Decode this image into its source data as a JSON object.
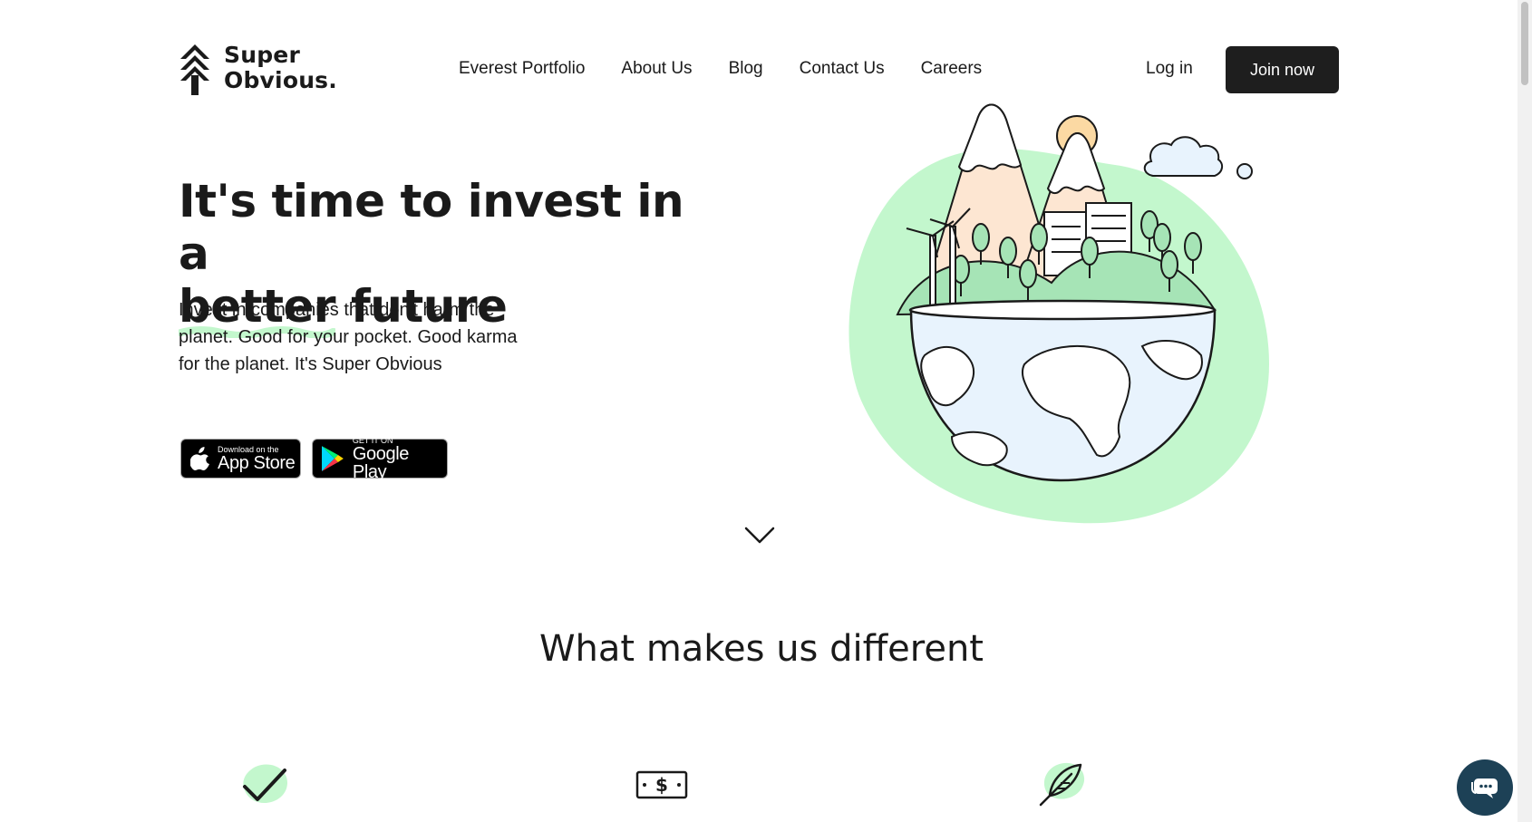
{
  "logo": {
    "line1": "Super",
    "line2": "Obvious."
  },
  "nav": {
    "items": [
      {
        "label": "Everest Portfolio"
      },
      {
        "label": "About Us"
      },
      {
        "label": "Blog"
      },
      {
        "label": "Contact Us"
      },
      {
        "label": "Careers"
      }
    ],
    "login_label": "Log in",
    "join_label": "Join now"
  },
  "hero": {
    "title_part1": "It's time to invest in a",
    "title_highlight": "better",
    "title_part2": "future",
    "subtitle": "Invest in companies that don't harm the planet. Good for your pocket. Good karma for the planet. It's Super Obvious"
  },
  "stores": {
    "apple": {
      "small": "Download on the",
      "big": "App Store"
    },
    "google": {
      "small": "GET IT ON",
      "big": "Google Play"
    }
  },
  "section": {
    "title": "What makes us different"
  },
  "features": [
    {
      "icon": "checkmark-icon"
    },
    {
      "icon": "dollar-bill-icon"
    },
    {
      "icon": "feather-leaf-icon"
    }
  ],
  "colors": {
    "accent_green": "#c3f7cd",
    "dark_button": "#1e1e1e",
    "chat_bubble": "#1d4156"
  }
}
